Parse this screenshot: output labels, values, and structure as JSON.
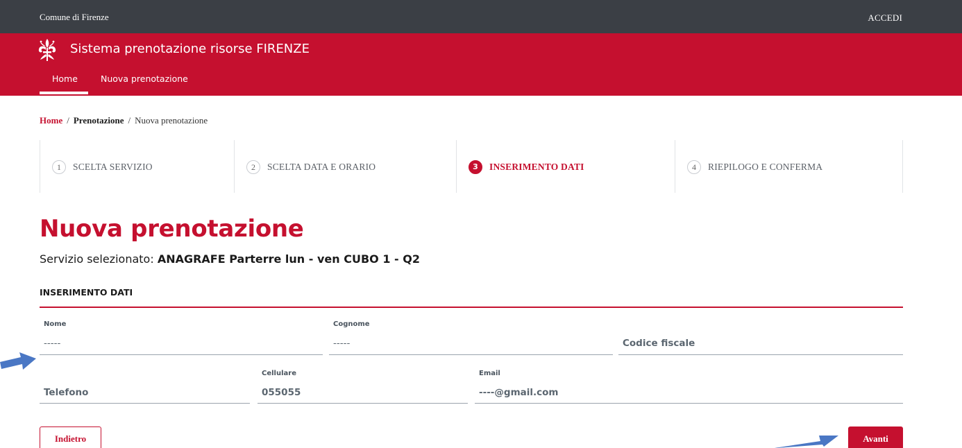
{
  "topbar": {
    "city": "Comune di Firenze",
    "login": "ACCEDI"
  },
  "header": {
    "title": "Sistema prenotazione risorse FIRENZE"
  },
  "nav": {
    "items": [
      {
        "label": "Home"
      },
      {
        "label": "Nuova prenotazione"
      }
    ]
  },
  "breadcrumb": {
    "home": "Home",
    "section": "Prenotazione",
    "current": "Nuova prenotazione",
    "separator": "/"
  },
  "steps": [
    {
      "number": "1",
      "label": "SCELTA SERVIZIO"
    },
    {
      "number": "2",
      "label": "SCELTA DATA E ORARIO"
    },
    {
      "number": "3",
      "label": "INSERIMENTO DATI"
    },
    {
      "number": "4",
      "label": "RIEPILOGO E CONFERMA"
    }
  ],
  "page": {
    "title": "Nuova prenotazione",
    "service_prefix": "Servizio selezionato:",
    "service_value": "ANAGRAFE Parterre lun - ven CUBO 1 - Q2",
    "section_title": "INSERIMENTO DATI"
  },
  "form": {
    "nome": {
      "label": "Nome",
      "value": "-----"
    },
    "cognome": {
      "label": "Cognome",
      "value": "-----"
    },
    "codice_fiscale": {
      "placeholder": "Codice fiscale"
    },
    "telefono": {
      "placeholder": "Telefono"
    },
    "cellulare": {
      "label": "Cellulare",
      "value": "055055"
    },
    "email": {
      "label": "Email",
      "value": "----@gmail.com"
    }
  },
  "buttons": {
    "back": "Indietro",
    "next": "Avanti"
  },
  "colors": {
    "brand_red": "#c5102f",
    "topbar": "#3b3f45",
    "annotation_arrow": "#4a77c4"
  }
}
